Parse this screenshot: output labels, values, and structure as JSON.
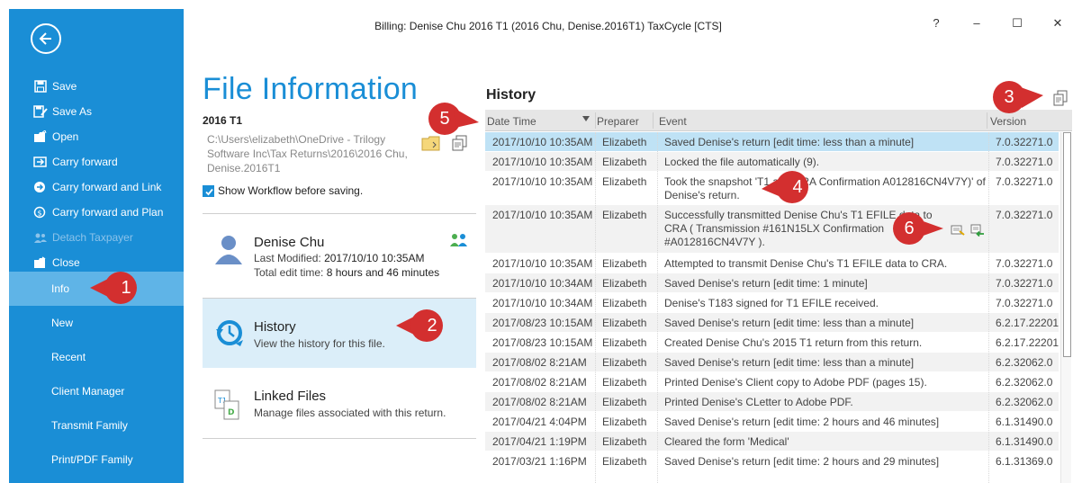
{
  "window": {
    "title": "Billing: Denise Chu 2016 T1 (2016 Chu, Denise.2016T1) TaxCycle [CTS]",
    "help_label": "?",
    "minimize_label": "–",
    "maximize_label": "☐",
    "close_label": "✕"
  },
  "sidebar": {
    "top_items": [
      {
        "label": "Save",
        "icon": "save-icon"
      },
      {
        "label": "Save As",
        "icon": "save-as-icon"
      },
      {
        "label": "Open",
        "icon": "open-icon"
      },
      {
        "label": "Carry forward",
        "icon": "carry-forward-icon"
      },
      {
        "label": "Carry forward and Link",
        "icon": "carry-forward-link-icon"
      },
      {
        "label": "Carry forward and Plan",
        "icon": "carry-forward-plan-icon"
      },
      {
        "label": "Detach Taxpayer",
        "icon": "detach-taxpayer-icon"
      },
      {
        "label": "Close",
        "icon": "close-folder-icon"
      }
    ],
    "big_items": [
      {
        "label": "Info"
      },
      {
        "label": "New"
      },
      {
        "label": "Recent"
      },
      {
        "label": "Client Manager"
      },
      {
        "label": "Transmit Family"
      },
      {
        "label": "Print/PDF Family"
      }
    ]
  },
  "file_info": {
    "title": "File Information",
    "year": "2016 T1",
    "path": "C:\\Users\\elizabeth\\OneDrive - Trilogy Software Inc\\Tax Returns\\2016\\2016 Chu, Denise.2016T1",
    "workflow_label": "Show Workflow before saving.",
    "person": {
      "name": "Denise Chu",
      "last_modified_label": "Last Modified:",
      "last_modified": "2017/10/10 10:35AM",
      "edit_time_label": "Total edit time:",
      "edit_time": "8 hours and 46 minutes"
    },
    "history_card": {
      "title": "History",
      "subtitle": "View the history for this file."
    },
    "linked_card": {
      "title": "Linked Files",
      "subtitle": "Manage files associated with this return."
    }
  },
  "history": {
    "title": "History",
    "columns": {
      "date": "Date Time",
      "preparer": "Preparer",
      "event": "Event",
      "version": "Version"
    },
    "rows": [
      {
        "date": "2017/10/10 10:35AM",
        "preparer": "Elizabeth",
        "event": "Saved Denise's return [edit time: less than a minute]",
        "version": "7.0.32271.0"
      },
      {
        "date": "2017/10/10 10:35AM",
        "preparer": "Elizabeth",
        "event": "Locked the file automatically (9).",
        "version": "7.0.32271.0"
      },
      {
        "date": "2017/10/10 10:35AM",
        "preparer": "Elizabeth",
        "event": "Took the snapshot 'T1 and CRA Confirmation A012816CN4V7Y)' of Denise's return.",
        "version": "7.0.32271.0"
      },
      {
        "date": "2017/10/10 10:35AM",
        "preparer": "Elizabeth",
        "event": "Successfully transmitted Denise Chu's T1 EFILE data to CRA ( Transmission #161N15LX Confirmation #A012816CN4V7Y ).",
        "version": "7.0.32271.0"
      },
      {
        "date": "2017/10/10 10:35AM",
        "preparer": "Elizabeth",
        "event": "Attempted to transmit Denise Chu's T1 EFILE data to CRA.",
        "version": "7.0.32271.0"
      },
      {
        "date": "2017/10/10 10:34AM",
        "preparer": "Elizabeth",
        "event": "Saved Denise's return [edit time: 1 minute]",
        "version": "7.0.32271.0"
      },
      {
        "date": "2017/10/10 10:34AM",
        "preparer": "Elizabeth",
        "event": "Denise's T183 signed for T1 EFILE received.",
        "version": "7.0.32271.0"
      },
      {
        "date": "2017/08/23 10:15AM",
        "preparer": "Elizabeth",
        "event": "Saved Denise's return [edit time: less than a minute]",
        "version": "6.2.17.22201"
      },
      {
        "date": "2017/08/23 10:15AM",
        "preparer": "Elizabeth",
        "event": "Created Denise Chu's 2015 T1 return from this return.",
        "version": "6.2.17.22201"
      },
      {
        "date": "2017/08/02 8:21AM",
        "preparer": "Elizabeth",
        "event": "Saved Denise's return [edit time: less than a minute]",
        "version": "6.2.32062.0"
      },
      {
        "date": "2017/08/02 8:21AM",
        "preparer": "Elizabeth",
        "event": "Printed Denise's Client copy to Adobe PDF (pages 15).",
        "version": "6.2.32062.0"
      },
      {
        "date": "2017/08/02 8:21AM",
        "preparer": "Elizabeth",
        "event": "Printed Denise's CLetter to Adobe PDF.",
        "version": "6.2.32062.0"
      },
      {
        "date": "2017/04/21 4:04PM",
        "preparer": "Elizabeth",
        "event": "Saved Denise's return [edit time: 2 hours and 46 minutes]",
        "version": "6.1.31490.0"
      },
      {
        "date": "2017/04/21 1:19PM",
        "preparer": "Elizabeth",
        "event": "Cleared the form 'Medical'",
        "version": "6.1.31490.0"
      },
      {
        "date": "2017/03/21 1:16PM",
        "preparer": "Elizabeth",
        "event": "Saved Denise's return [edit time: 2 hours and 29 minutes]",
        "version": "6.1.31369.0"
      }
    ]
  },
  "callouts": [
    "1",
    "2",
    "3",
    "4",
    "5",
    "6"
  ],
  "colors": {
    "accent": "#1a8ed6",
    "sidebar_active": "#5fb4e7",
    "callout": "#d32f2f",
    "selected_row": "#bfe2f5"
  }
}
